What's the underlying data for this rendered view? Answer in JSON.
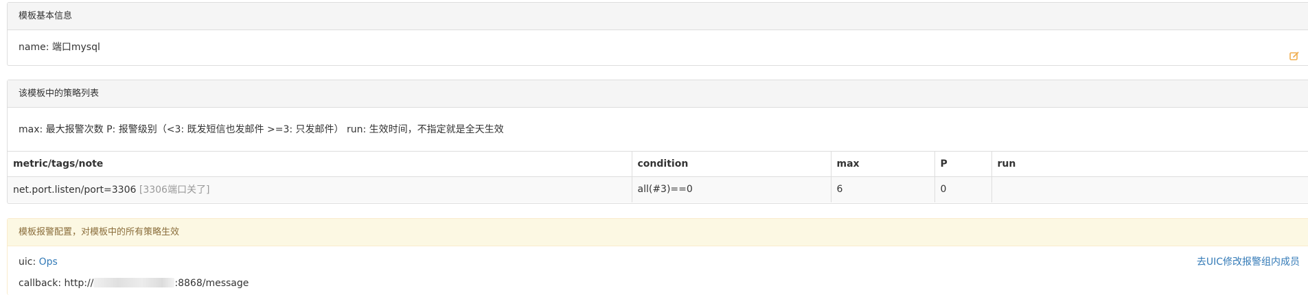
{
  "basic_panel": {
    "title": "模板基本信息",
    "name_label": "name:",
    "name_value": "端口mysql",
    "edit_icon": "edit-icon",
    "edit_color": "#f0ad4e"
  },
  "strategy_panel": {
    "title": "该模板中的策略列表",
    "description": "max: 最大报警次数 P: 报警级别（<3: 既发短信也发邮件 >=3: 只发邮件） run: 生效时间，不指定就是全天生效",
    "columns": [
      "metric/tags/note",
      "condition",
      "max",
      "P",
      "run"
    ],
    "rows": [
      {
        "metric": "net.port.listen/port=3306",
        "note": "[3306端口关了]",
        "condition": "all(#3)==0",
        "max": "6",
        "p": "0",
        "run": ""
      }
    ]
  },
  "alarm_panel": {
    "title": "模板报警配置，对模板中的所有策略生效",
    "uic_label": "uic:",
    "uic_value": "Ops",
    "uic_link": "去UIC修改报警组内成员",
    "callback_label": "callback:",
    "callback_prefix": "http://",
    "callback_suffix": ":8868/message",
    "link_color": "#337ab7"
  }
}
